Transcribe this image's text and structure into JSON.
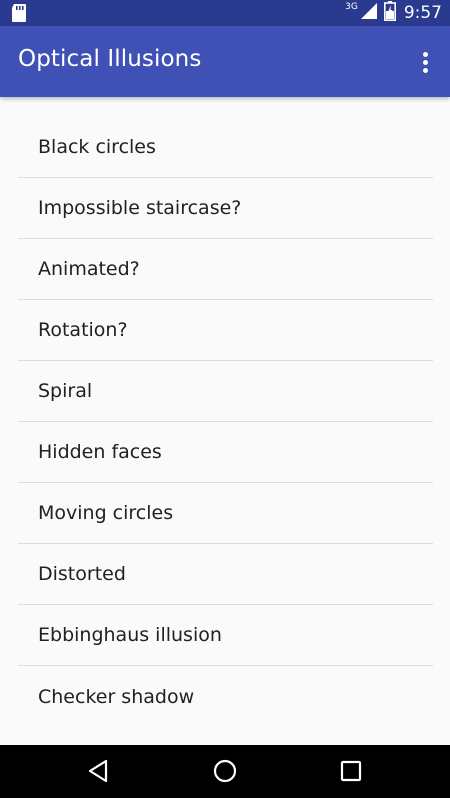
{
  "status_bar": {
    "network": "3G",
    "time": "9:57",
    "background_color": "#2a3b8f",
    "icons": [
      "sd-card-icon",
      "signal-icon",
      "battery-icon"
    ]
  },
  "app_bar": {
    "title": "Optical Illusions",
    "background_color": "#3f51b5",
    "menu_icon": "overflow-menu-icon"
  },
  "list": {
    "items": [
      {
        "label": "Black circles"
      },
      {
        "label": "Impossible staircase?"
      },
      {
        "label": "Animated?"
      },
      {
        "label": "Rotation?"
      },
      {
        "label": "Spiral"
      },
      {
        "label": "Hidden faces"
      },
      {
        "label": "Moving circles"
      },
      {
        "label": "Distorted"
      },
      {
        "label": "Ebbinghaus illusion"
      },
      {
        "label": "Checker shadow"
      }
    ]
  },
  "nav_bar": {
    "buttons": [
      "back-icon",
      "home-icon",
      "recents-icon"
    ]
  }
}
